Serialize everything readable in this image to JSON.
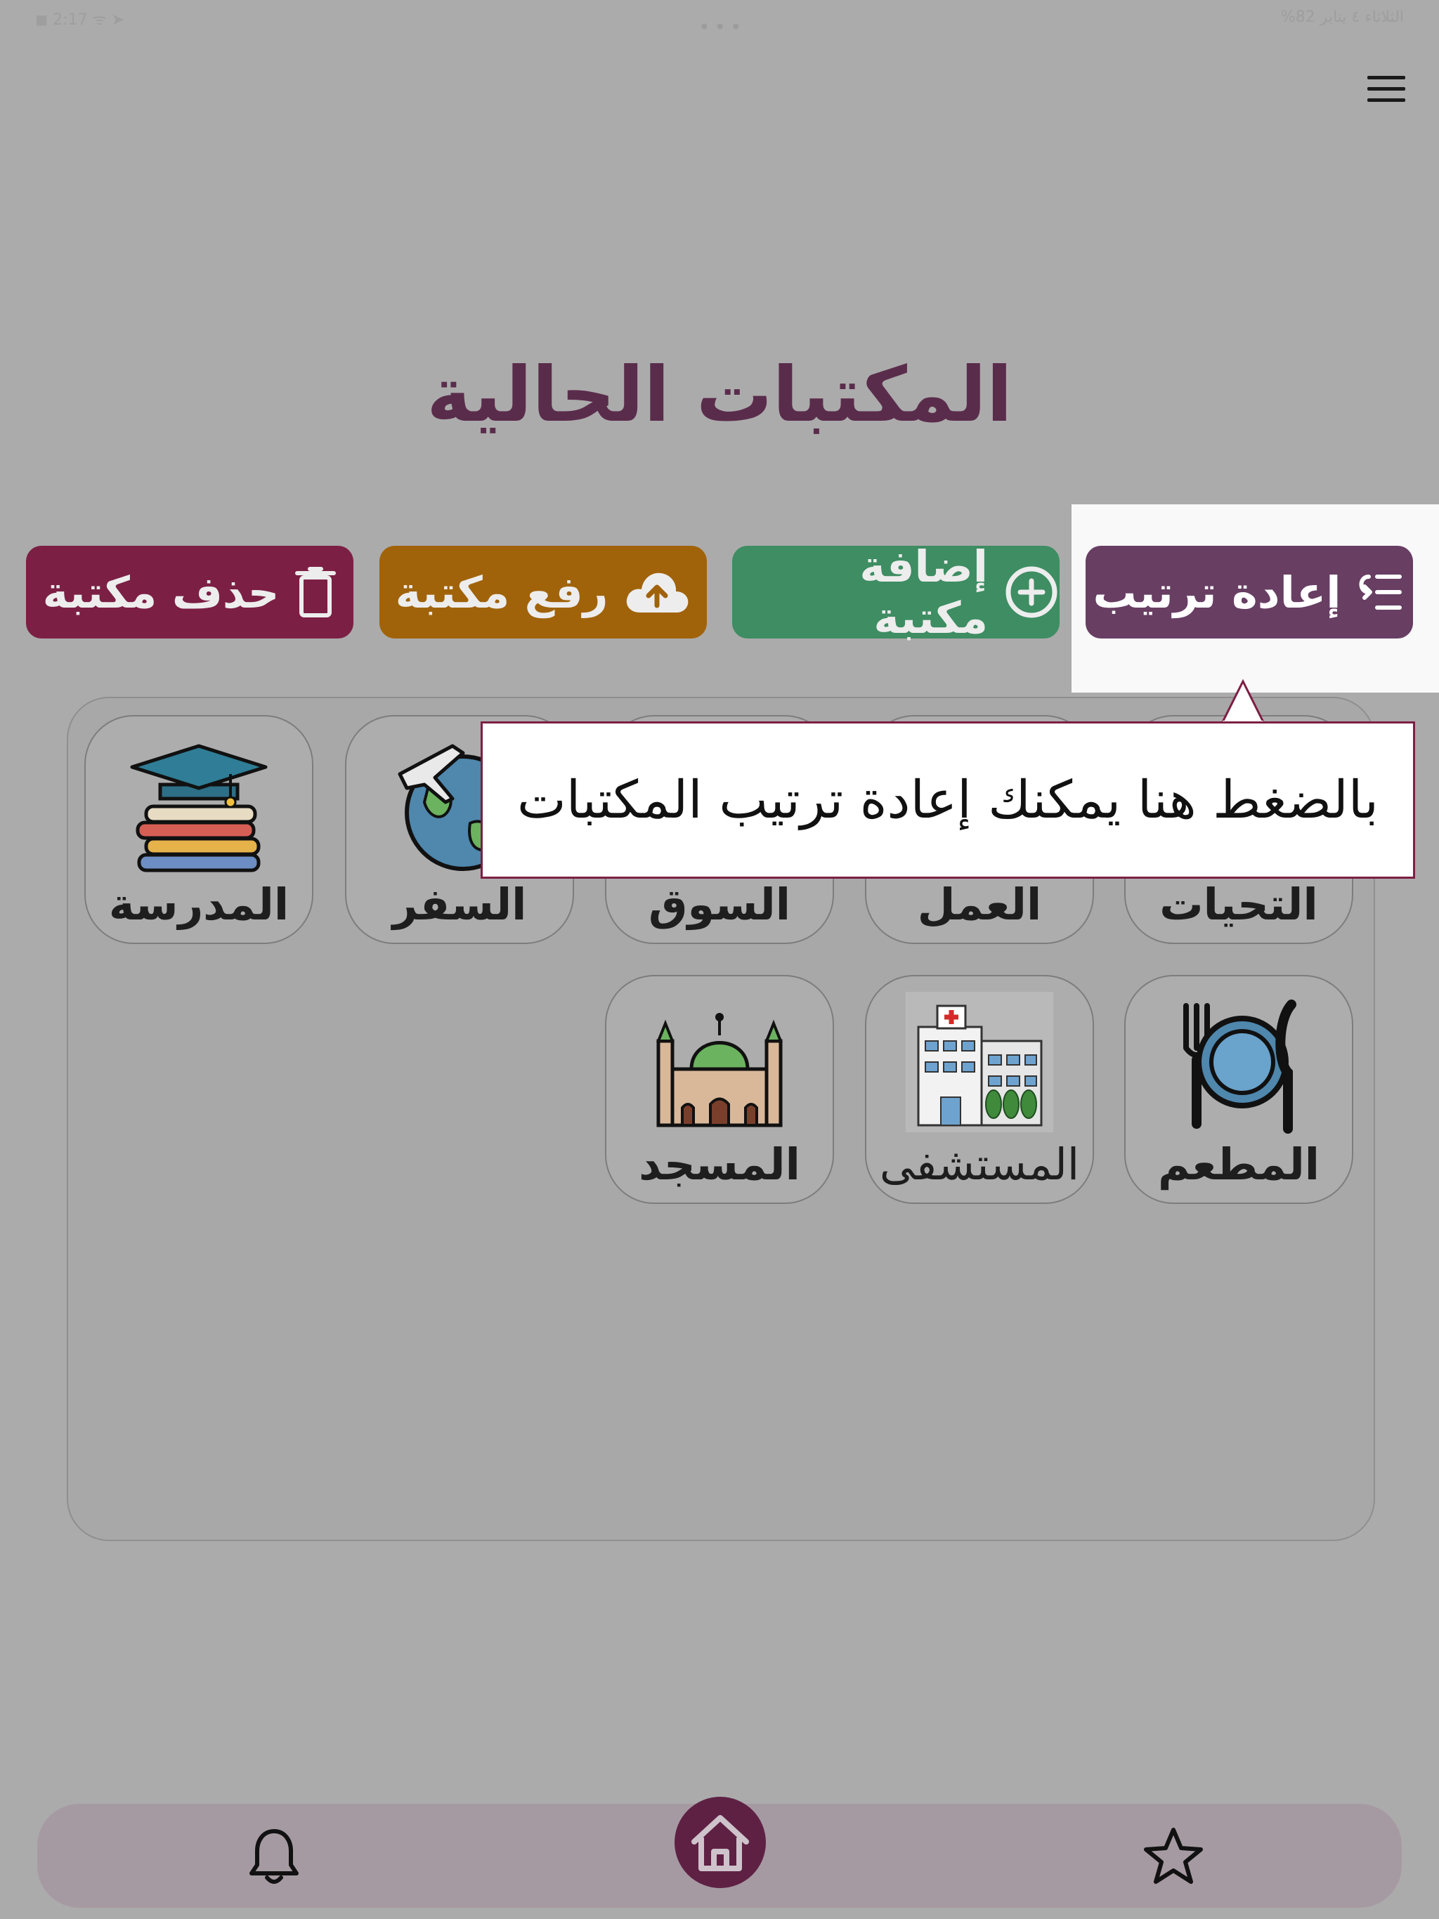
{
  "page": {
    "title": "المكتبات الحالية"
  },
  "statusbar": {
    "left_text": "◼ 2:17  ᯤ ➤",
    "right_text": "الثلاثاء ٤ يناير  82%"
  },
  "menu": {
    "icon": "hamburger-menu-icon"
  },
  "actions": {
    "reorder_label": "إعادة ترتيب",
    "add_label": "إضافة مكتبة",
    "upload_label": "رفع مكتبة",
    "delete_label": "حذف مكتبة"
  },
  "colors": {
    "reorder": "#683e63",
    "add": "#3e8d63",
    "upload": "#a0630a",
    "delete": "#7c1f44",
    "title": "#5a2c4b"
  },
  "libraries": {
    "row1": [
      {
        "label": "التحيات",
        "icon": "greetings-icon"
      },
      {
        "label": "العمل",
        "icon": "work-icon"
      },
      {
        "label": "السوق",
        "icon": "market-icon"
      },
      {
        "label": "السفر",
        "icon": "travel-globe-plane-icon"
      },
      {
        "label": "المدرسة",
        "icon": "school-books-cap-icon"
      }
    ],
    "row2": [
      {
        "label": "المطعم",
        "icon": "restaurant-plate-icon"
      },
      {
        "label": "المستشفى",
        "icon": "hospital-icon"
      },
      {
        "label": "المسجد",
        "icon": "mosque-icon"
      }
    ]
  },
  "tooltip": {
    "text": "بالضغط هنا يمكنك إعادة ترتيب المكتبات"
  },
  "bottom_nav": {
    "left": "bell-icon",
    "center": "home-icon",
    "right": "star-icon"
  }
}
